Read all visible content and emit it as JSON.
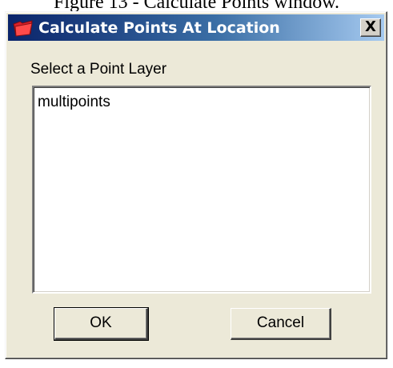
{
  "caption": "Figure 13 - Calculate Points window.",
  "window": {
    "title": "Calculate Points At Location",
    "close_glyph": "X",
    "app_icon": "red-folder-icon",
    "title_gradient": [
      "#0a246a",
      "#3a6ea5",
      "#a6caf0"
    ]
  },
  "dialog": {
    "prompt": "Select a Point Layer",
    "list_items": [
      "multipoints"
    ]
  },
  "buttons": {
    "ok_label": "OK",
    "cancel_label": "Cancel"
  }
}
